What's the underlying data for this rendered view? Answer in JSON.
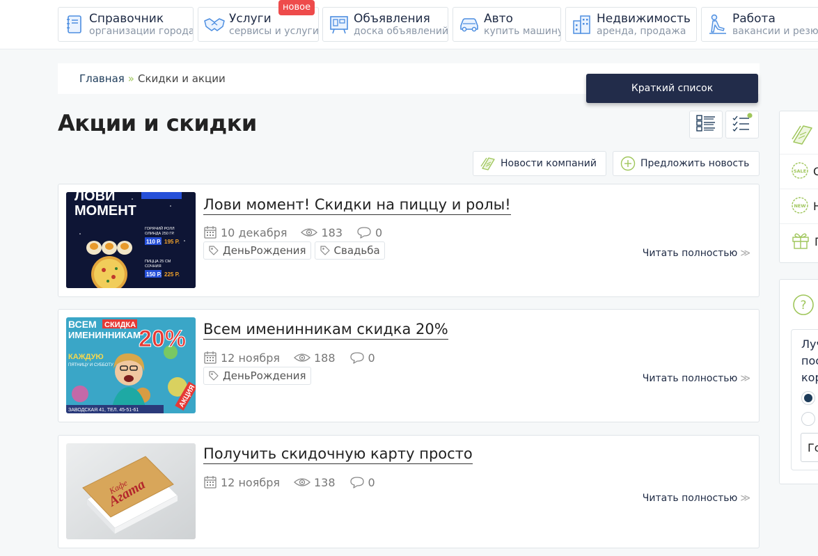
{
  "nav": [
    {
      "title": "Справочник",
      "sub": "организации города",
      "icon": "directory-book-icon"
    },
    {
      "title": "Услуги",
      "sub": "сервисы и услуги",
      "icon": "handshake-icon",
      "badge": "новое"
    },
    {
      "title": "Объявления",
      "sub": "доска объявлений",
      "icon": "board-icon"
    },
    {
      "title": "Авто",
      "sub": "купить машину",
      "icon": "car-icon"
    },
    {
      "title": "Недвижимость",
      "sub": "аренда, продажа",
      "icon": "buildings-icon"
    },
    {
      "title": "Работа",
      "sub": "вакансии и резюме",
      "icon": "worker-icon"
    }
  ],
  "breadcrumb": {
    "home": "Главная",
    "separator": "»",
    "current": "Скидки и акции"
  },
  "short_list_label": "Краткий список",
  "page_title": "Акции и скидки",
  "actions": {
    "company_news": "Новости компаний",
    "suggest_news": "Предложить новость"
  },
  "articles": [
    {
      "title": "Лови момент! Скидки на пиццу и ролы!",
      "date": "10 декабря",
      "views": "183",
      "comments": "0",
      "tags": [
        "ДеньРождения",
        "Свадьба"
      ],
      "read_more": "Читать полностью",
      "thumb": {
        "line1": "ЛОВИ",
        "line2": "МОМЕНТ",
        "text_a": "ГОРЯЧИЙ РОЛЛ",
        "text_b": "ОЛИНДА 250 ГР.",
        "price_a": "110 Р.",
        "price_a2": "195 Р.",
        "text_c": "ПИЦЦА 25 СМ",
        "text_d": "СОЧНИЯ",
        "price_b": "150 Р.",
        "price_b2": "225 Р."
      }
    },
    {
      "title": "Всем именинникам скидка 20%",
      "date": "12 ноября",
      "views": "188",
      "comments": "0",
      "tags": [
        "ДеньРождения"
      ],
      "read_more": "Читать полностью",
      "thumb": {
        "w1": "ВСЕМ",
        "w2": "СКИДКА",
        "w3": "ИМЕНИННИКАМ",
        "pct": "20%",
        "w4": "КАЖДУЮ",
        "w5": "ПЯТНИЦУ И СУББОТУ",
        "w6": "АКЦИЯ",
        "addr": "ЗАВОДСКАЯ 41, ТЕЛ. 45-51-61"
      }
    },
    {
      "title": "Получить скидочную карту просто",
      "date": "12 ноября",
      "views": "138",
      "comments": "0",
      "tags": [],
      "read_more": "Читать полностью",
      "thumb": {
        "k1": "Кафе",
        "k2": "Агата"
      }
    }
  ],
  "sidebar": {
    "rows": [
      {
        "icon": "news-papers-icon",
        "letter": ""
      },
      {
        "icon": "sale-badge-icon",
        "letter": "С"
      },
      {
        "icon": "new-badge-icon",
        "letter": "Н"
      },
      {
        "icon": "gift-icon",
        "letter": "П"
      }
    ],
    "poll": {
      "lines": [
        "Луч",
        "пос",
        "кор"
      ],
      "button": "Го"
    }
  },
  "colors": {
    "accent_green": "#9fc65b",
    "dark_navy": "#222c4a",
    "badge_red": "#ee4b4b"
  }
}
